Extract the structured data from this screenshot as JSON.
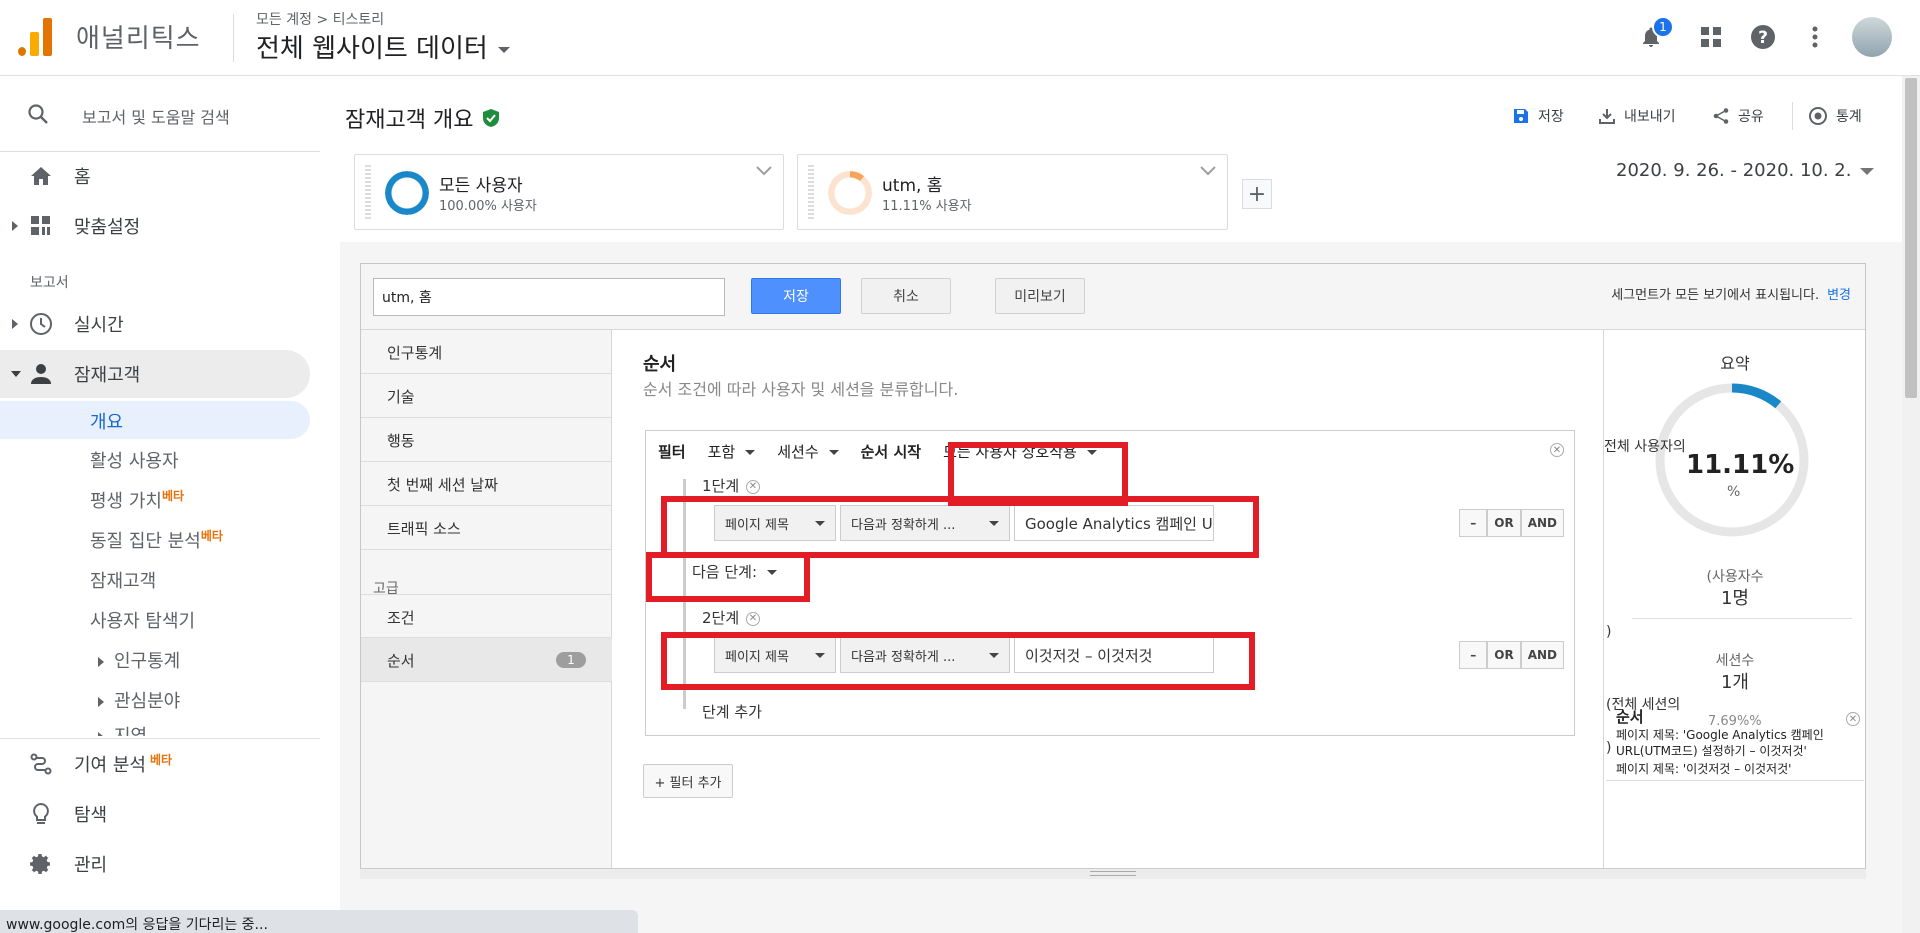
{
  "app": {
    "name": "애널리틱스"
  },
  "account": {
    "breadcrumb_root": "모든 계정",
    "breadcrumb_sep": ">",
    "breadcrumb_property": "티스토리",
    "view_name": "전체 웹사이트 데이터"
  },
  "topbar": {
    "notification_count": "1"
  },
  "sidebar": {
    "search_label": "보고서 및 도움말 검색",
    "home": "홈",
    "customization": "맞춤설정",
    "reports_section": "보고서",
    "realtime": "실시간",
    "audience": "잠재고객",
    "audience_items": {
      "overview": "개요",
      "active_users": "활성 사용자",
      "lifetime_value": "평생 가치",
      "cohort": "동질 집단 분석",
      "audiences": "잠재고객",
      "user_explorer": "사용자 탐색기",
      "demographics": "인구통계",
      "interests": "관심분야",
      "geo": "지역"
    },
    "beta": "베타",
    "attribution": "기여 분석",
    "discover": "탐색",
    "admin": "관리"
  },
  "status_bar": "www.google.com의 응답을 기다리는 중...",
  "page": {
    "title": "잠재고객 개요",
    "actions": {
      "save": "저장",
      "export": "내보내기",
      "share": "공유",
      "insights": "통계"
    },
    "date_range": "2020. 9. 26. - 2020. 10. 2."
  },
  "segments": [
    {
      "name": "모든 사용자",
      "pct": "100.00% 사용자",
      "color": "#1a87c9"
    },
    {
      "name": "utm, 홈",
      "pct": "11.11% 사용자",
      "color": "#f7a35c"
    }
  ],
  "editor": {
    "segment_name": "utm, 홈",
    "save": "저장",
    "cancel": "취소",
    "preview": "미리보기",
    "note": "세그먼트가 모든 보기에서 표시됩니다.",
    "note_link": "변경",
    "categories": [
      "인구통계",
      "기술",
      "행동",
      "첫 번째 세션 날짜",
      "트래픽 소스"
    ],
    "advanced_label": "고급",
    "advanced": [
      "조건",
      "순서"
    ],
    "sequence_badge": "1",
    "sequence": {
      "title": "순서",
      "subtitle": "순서 조건에 따라 사용자 및 세션을 분류합니다.",
      "filter_label": "필터",
      "include": "포함",
      "scope": "세션수",
      "start_label": "순서 시작",
      "start_value": "모든 사용자 상호작용",
      "step1": "1단계",
      "step2": "2단계",
      "dim": "페이지 제목",
      "match": "다음과 정확하게 ...",
      "step1_value": "Google Analytics 캠페인 URL(UTM코드) 설정하기 – 이것저것",
      "step2_value": "이것저것 – 이것저것",
      "next_step": "다음 단계:",
      "add_step": "단계 추가",
      "minus": "–",
      "or": "OR",
      "and": "AND",
      "add_filter": "+ 필터 추가"
    },
    "summary": {
      "title": "요약",
      "of_all_users": "전체 사용자의",
      "pct": "11.11%",
      "pct_value": 11.11,
      "unit": "%",
      "users_label": "(사용자수",
      "users_value": "1명",
      "paren": ")",
      "sessions_label": "세션수",
      "sessions_value": "1개",
      "of_all_sessions": "(전체 세션의",
      "sessions_pct": "7.69%%",
      "seq_label": "순서",
      "seq_line1": "페이지 제목: 'Google Analytics 캠페인",
      "seq_line2": "URL(UTM코드) 설정하기 – 이것저것'",
      "seq_line3": "페이지 제목: '이것저것 – 이것저것'"
    }
  }
}
